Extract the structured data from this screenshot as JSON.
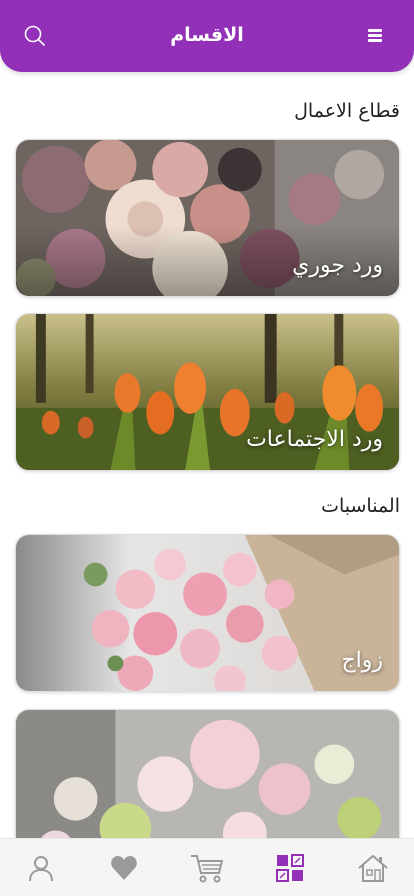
{
  "header": {
    "title": "الاقسام",
    "menu_icon": "hamburger-menu-icon",
    "search_icon": "search-icon",
    "background_color": "#9230b8"
  },
  "sections": [
    {
      "title": "قطاع الاعمال",
      "cards": [
        {
          "label": "ورد جوري",
          "image": "roses-bouquet-photo"
        },
        {
          "label": "ورد الاجتماعات",
          "image": "orange-tulips-photo"
        }
      ]
    },
    {
      "title": "المناسبات",
      "cards": [
        {
          "label": "زواج",
          "image": "pink-roses-wrapped-bouquet-photo"
        },
        {
          "label": "",
          "image": "peonies-bouquet-photo"
        }
      ]
    }
  ],
  "tabbar": {
    "items": [
      {
        "name": "profile",
        "icon": "user-icon"
      },
      {
        "name": "favorites",
        "icon": "heart-icon"
      },
      {
        "name": "cart",
        "icon": "cart-icon"
      },
      {
        "name": "categories",
        "icon": "categories-grid-icon",
        "active": true
      },
      {
        "name": "home",
        "icon": "home-icon"
      }
    ],
    "active_color": "#9230b8",
    "inactive_color": "#9a9a9a"
  }
}
